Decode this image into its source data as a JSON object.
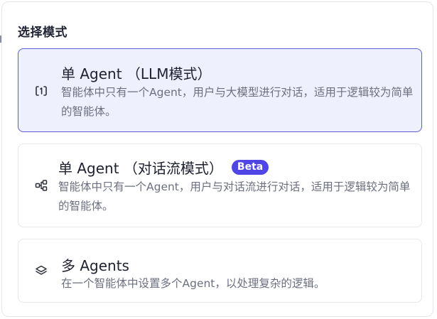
{
  "dialog": {
    "title": "选择模式"
  },
  "options": [
    {
      "title": "单 Agent （LLM模式）",
      "description": "智能体中只有一个Agent，用户与大模型进行对话，适用于逻辑较为简单的智能体。",
      "icon": "single-agent-icon",
      "selected": true
    },
    {
      "title": "单 Agent （对话流模式）",
      "badge": "Beta",
      "description": "智能体中只有一个Agent，用户与对话流进行对话，适用于逻辑较为简单的智能体。",
      "icon": "workflow-icon",
      "selected": false
    },
    {
      "title": "多 Agents",
      "description": "在一个智能体中设置多个Agent，以处理复杂的逻辑。",
      "icon": "layers-icon",
      "selected": false
    }
  ],
  "colors": {
    "accent": "#4f46e5",
    "selected_bg": "#eff0fd",
    "selected_border": "#5a5fd6",
    "description_text": "#6b7080"
  }
}
